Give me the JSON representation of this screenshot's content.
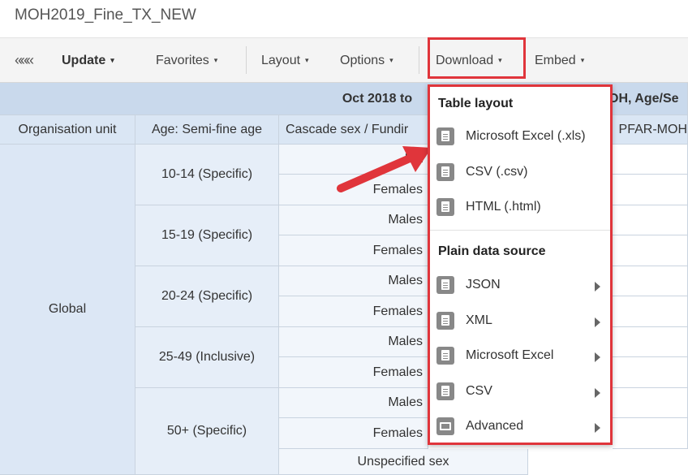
{
  "page_title": "MOH2019_Fine_TX_NEW",
  "toolbar": {
    "collapse_glyph": "«««",
    "update_label": "Update",
    "favorites_label": "Favorites",
    "layout_label": "Layout",
    "options_label": "Options",
    "download_label": "Download",
    "embed_label": "Embed",
    "caret": "▾"
  },
  "table": {
    "title_row": "Oct 2018 to",
    "title_row_right": "OH, Age/Se",
    "headers": [
      "Organisation unit",
      "Age: Semi-fine age",
      "Cascade sex / Fundir",
      "PFAR-MOH"
    ],
    "org_unit": "Global",
    "age_groups": [
      "10-14 (Specific)",
      "15-19 (Specific)",
      "20-24 (Specific)",
      "25-49 (Inclusive)",
      "50+ (Specific)"
    ],
    "sex_rows": [
      "Ma",
      "Females",
      "Males",
      "Females",
      "Males",
      "Females",
      "Males",
      "Females",
      "Males",
      "Females",
      "Unspecified sex"
    ]
  },
  "download_menu": {
    "table_layout_header": "Table layout",
    "table_layout_items": [
      "Microsoft Excel (.xls)",
      "CSV (.csv)",
      "HTML (.html)"
    ],
    "plain_source_header": "Plain data source",
    "plain_source_items": [
      "JSON",
      "XML",
      "Microsoft Excel",
      "CSV",
      "Advanced"
    ]
  },
  "colors": {
    "highlight": "#e0353b",
    "header_bg": "#dae6f4",
    "icon_gray": "#888888"
  }
}
